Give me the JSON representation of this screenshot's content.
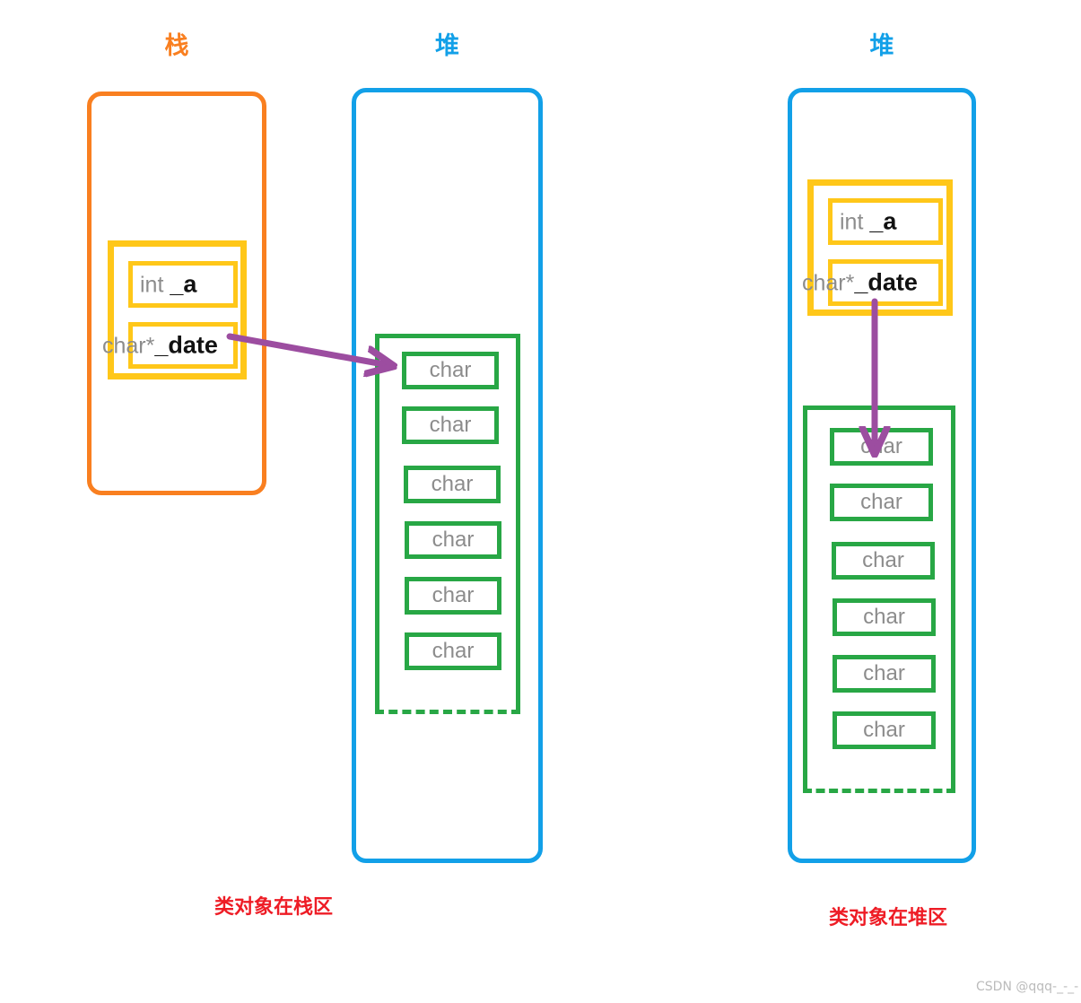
{
  "diagram": {
    "title_watermark": "CSDN @qqq-_-_-",
    "colors": {
      "stack": "#F97F20",
      "heap": "#12A0E8",
      "object": "#FFC719",
      "char_array": "#28A745",
      "pointer": "#9C4DA0",
      "caption": "#EE1C25",
      "type_text": "#8C8C8C",
      "name_text": "#111111"
    }
  },
  "left_panel": {
    "stack_region": {
      "heading": "栈",
      "object": {
        "members": [
          {
            "type": "int ",
            "name": "_a"
          },
          {
            "type": "char*",
            "name": "_date"
          }
        ]
      }
    },
    "heap_region": {
      "heading": "堆",
      "char_array": {
        "cells": [
          "char",
          "char",
          "char",
          "char",
          "char",
          "char"
        ]
      }
    },
    "caption": "类对象在栈区"
  },
  "right_panel": {
    "heap_region": {
      "heading": "堆",
      "object": {
        "members": [
          {
            "type": "int ",
            "name": "_a"
          },
          {
            "type": "char*",
            "name": "_date"
          }
        ]
      },
      "char_array": {
        "cells": [
          "char",
          "char",
          "char",
          "char",
          "char",
          "char"
        ]
      }
    },
    "caption": "类对象在堆区"
  }
}
